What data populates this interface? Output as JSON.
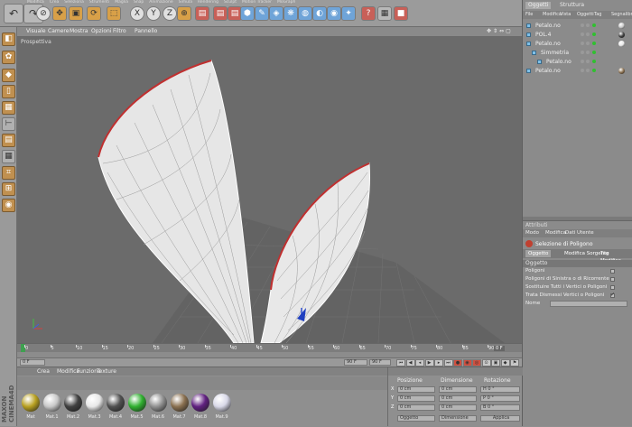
{
  "toolbar": {
    "buttons": [
      {
        "icon": "undo-icon",
        "glyph": "↶"
      },
      {
        "icon": "redo-icon",
        "glyph": "↷"
      },
      {
        "icon": "live-select-icon",
        "glyph": "⊘"
      },
      {
        "icon": "move-icon",
        "glyph": "✥"
      },
      {
        "icon": "scale-icon",
        "glyph": "▣"
      },
      {
        "icon": "rotate-icon",
        "glyph": "⟳"
      },
      {
        "icon": "object-icon",
        "glyph": "⬚"
      },
      {
        "icon": "x-axis-icon",
        "glyph": "X"
      },
      {
        "icon": "y-axis-icon",
        "glyph": "Y"
      },
      {
        "icon": "z-axis-icon",
        "glyph": "Z"
      },
      {
        "icon": "coordinate-system-icon",
        "glyph": "⊕"
      },
      {
        "icon": "render-view-icon",
        "glyph": "▤"
      },
      {
        "icon": "render-picture-icon",
        "glyph": "▤"
      },
      {
        "icon": "render-settings-icon",
        "glyph": "▤"
      },
      {
        "icon": "cube-icon",
        "glyph": "⬢"
      },
      {
        "icon": "spline-pen-icon",
        "glyph": "✎"
      },
      {
        "icon": "subdivision-icon",
        "glyph": "◈"
      },
      {
        "icon": "array-icon",
        "glyph": "❋"
      },
      {
        "icon": "deformer-icon",
        "glyph": "◍"
      },
      {
        "icon": "scene-icon",
        "glyph": "◐"
      },
      {
        "icon": "camera-icon",
        "glyph": "◉"
      },
      {
        "icon": "light-icon",
        "glyph": "✦"
      },
      {
        "icon": "python-icon",
        "glyph": "?"
      },
      {
        "icon": "calculator-icon",
        "glyph": "▦"
      },
      {
        "icon": "stop-icon",
        "glyph": "■"
      }
    ],
    "menu_row": [
      "Modifica",
      "Crea",
      "Seleziona",
      "Strumenti",
      "Maglia",
      "Snap",
      "Animazione",
      "Simula",
      "Rendering",
      "Sculpt",
      "Motion Tracker",
      "MoGraph",
      "Personaggio",
      "Plugin",
      "Script",
      "Finestra",
      "Aiuto"
    ]
  },
  "left_tools": {
    "icons": [
      "make-editable-icon",
      "texture-icon",
      "points-icon",
      "edges-icon",
      "polygons-icon",
      "axis-icon",
      "tweak-icon",
      "grid-icon",
      "enable-snap-icon",
      "workplane-icon",
      "lock-icon"
    ]
  },
  "viewport": {
    "menu": [
      "Visuale",
      "Camere",
      "Mostra",
      "Opzioni",
      "Filtro",
      "Pannello"
    ],
    "label": "Prospettiva"
  },
  "timeline": {
    "ticks": [
      "0",
      "5",
      "10",
      "15",
      "20",
      "25",
      "30",
      "35",
      "40",
      "45",
      "50",
      "55",
      "60",
      "65",
      "70",
      "75",
      "80",
      "85",
      "90"
    ],
    "frame_label": "0 F",
    "start_field": "0 F",
    "end_field": "90 F",
    "current_field": "90 F"
  },
  "materials": {
    "menu": [
      "Crea",
      "Modifica",
      "Funzione",
      "Texture"
    ],
    "items": [
      {
        "name": "Mat",
        "color": "#b8a020"
      },
      {
        "name": "Mat.1",
        "color": "#c8c8c8"
      },
      {
        "name": "Mat.2",
        "color": "#404040"
      },
      {
        "name": "Mat.3",
        "color": "#e8e8e8"
      },
      {
        "name": "Mat.4",
        "color": "#505050"
      },
      {
        "name": "Mat.5",
        "color": "#30b030"
      },
      {
        "name": "Mat.6",
        "color": "#909090"
      },
      {
        "name": "Mat.7",
        "color": "#8a7050"
      },
      {
        "name": "Mat.8",
        "color": "#602080"
      },
      {
        "name": "Mat.9",
        "color": "#d8d8e8"
      }
    ]
  },
  "coordinates": {
    "headers": [
      "Posizione",
      "Dimensione",
      "Rotazione"
    ],
    "rows": [
      {
        "axis": "X",
        "pos": "0 cm",
        "dim": "0 cm",
        "rot": "H 0 °"
      },
      {
        "axis": "Y",
        "pos": "0 cm",
        "dim": "0 cm",
        "rot": "P 0 °"
      },
      {
        "axis": "Z",
        "pos": "0 cm",
        "dim": "0 cm",
        "rot": "B 0 °"
      }
    ],
    "mode_select": "Oggetto",
    "size_select": "Dimensione",
    "apply_button": "Applica"
  },
  "objects": {
    "tabs": [
      "Oggetti",
      "Struttura"
    ],
    "menu": [
      "File",
      "Modifica",
      "Vista",
      "Oggetti",
      "Tag",
      "Segnalibri"
    ],
    "rows": [
      {
        "name": "Petalo.no",
        "indent": 0,
        "tag": "#c8c8c8"
      },
      {
        "name": "POL.4",
        "indent": 0,
        "tag": "#404040"
      },
      {
        "name": "Petalo.no",
        "indent": 0,
        "tag": "#e8e8e8"
      },
      {
        "name": "Simmetria",
        "indent": 1,
        "tag": ""
      },
      {
        "name": "Petalo.no",
        "indent": 2,
        "tag": ""
      },
      {
        "name": "Petalo.no",
        "indent": 0,
        "tag": "#8a7050"
      }
    ]
  },
  "attributes": {
    "title": "Attributi",
    "menu": [
      "Modo",
      "Modifica",
      "Dati Utente"
    ],
    "object_name": "Selezione di Poligono",
    "tabs": [
      "Oggetto",
      "Modifica Sorgente",
      "Tag Modifica"
    ],
    "section": "Oggetto",
    "rows": [
      {
        "label": "Poligoni",
        "value": "",
        "checked": false
      },
      {
        "label": "Poligoni di Sinistra o di Ricorrente",
        "value": "",
        "checked": false
      },
      {
        "label": "Sostituire Tutti i Vertici o Poligoni",
        "value": "",
        "checked": false
      },
      {
        "label": "Trata Dismessi Vertici o Poligoni",
        "value": "",
        "checked": true
      },
      {
        "label": "Nome",
        "value": "",
        "checked": false
      }
    ]
  },
  "colors": {
    "accent_red": "#c03030",
    "wire_white": "#f4f4f4",
    "viewport_bg": "#6b6b6b"
  }
}
